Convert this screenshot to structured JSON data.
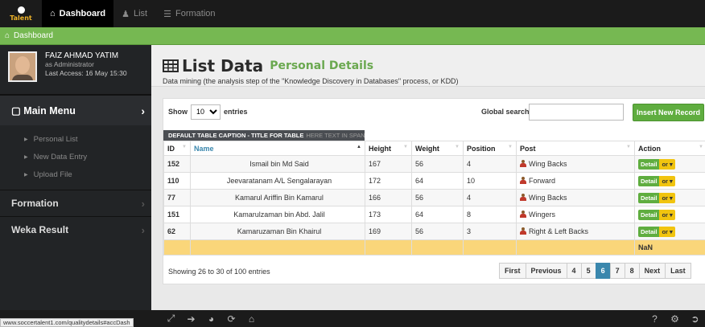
{
  "topnav": {
    "logo_text": "Talent",
    "tabs": [
      {
        "label": "Dashboard",
        "icon": "home-icon",
        "active": true
      },
      {
        "label": "List",
        "icon": "users-icon",
        "active": false
      },
      {
        "label": "Formation",
        "icon": "list-icon",
        "active": false
      }
    ]
  },
  "breadcrumb": {
    "label": "Dashboard"
  },
  "profile": {
    "name": "FAIZ AHMAD YATIM",
    "role": "as Administrator",
    "last_access": "Last Access: 16 May 15:30"
  },
  "sidebar": {
    "main_menu": "Main Menu",
    "items": [
      "Personal List",
      "New Data Entry",
      "Upload File"
    ],
    "groups": [
      "Formation",
      "Weka Result"
    ]
  },
  "page": {
    "title": "List Data",
    "subtitle": "Personal Details",
    "description": "Data mining (the analysis step of the \"Knowledge Discovery in Databases\" process, or KDD)"
  },
  "toolbar": {
    "show_label": "Show",
    "entries_value": "10",
    "entries_label": "entries",
    "search_label": "Global search:",
    "insert_button": "Insert New Record"
  },
  "table": {
    "caption": "DEFAULT TABLE CAPTION - TITLE FOR TABLE",
    "caption_light": "HERE TEXT IN SPAN",
    "columns": [
      "ID",
      "Name",
      "Height",
      "Weight",
      "Position",
      "Post",
      "Action"
    ],
    "rows": [
      {
        "id": "152",
        "name": "Ismail bin Md Said",
        "height": "167",
        "weight": "56",
        "position": "4",
        "post": "Wing Backs"
      },
      {
        "id": "110",
        "name": "Jeevaratanam A/L Sengalarayan",
        "height": "172",
        "weight": "64",
        "position": "10",
        "post": "Forward"
      },
      {
        "id": "77",
        "name": "Kamarul Ariffin Bin Kamarul",
        "height": "166",
        "weight": "56",
        "position": "4",
        "post": "Wing Backs"
      },
      {
        "id": "151",
        "name": "Kamarulzaman bin Abd. Jalil",
        "height": "173",
        "weight": "64",
        "position": "8",
        "post": "Wingers"
      },
      {
        "id": "62",
        "name": "Kamaruzaman Bin Khairul",
        "height": "169",
        "weight": "56",
        "position": "3",
        "post": "Right & Left Backs"
      }
    ],
    "action_detail": "Detail",
    "action_or": "or",
    "footer_value": "NaN"
  },
  "footer": {
    "showing": "Showing 26 to 30 of 100 entries",
    "pages": [
      "First",
      "Previous",
      "4",
      "5",
      "6",
      "7",
      "8",
      "Next",
      "Last"
    ],
    "current_page": "6"
  },
  "status_url": "www.soccertalent1.com/qualitydetails#accDash",
  "colors": {
    "accent_green": "#76b852",
    "pager_active": "#3a87ad",
    "footer_row": "#fad67a"
  }
}
